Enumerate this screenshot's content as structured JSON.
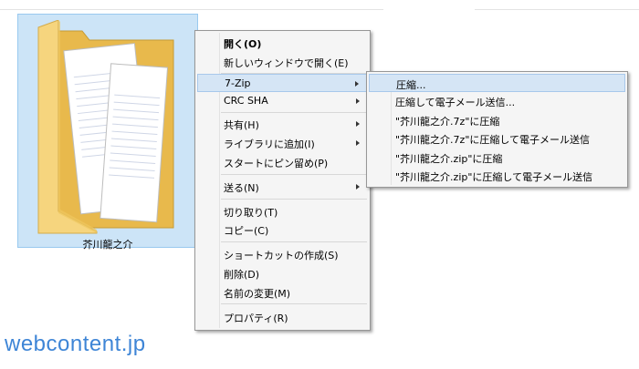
{
  "file": {
    "name": "芥川龍之介"
  },
  "context_menu": {
    "items": [
      {
        "label": "開く(O)"
      },
      {
        "label": "新しいウィンドウで開く(E)"
      },
      {
        "label": "7-Zip"
      },
      {
        "label": "CRC SHA"
      },
      {
        "label": "共有(H)"
      },
      {
        "label": "ライブラリに追加(I)"
      },
      {
        "label": "スタートにピン留め(P)"
      },
      {
        "label": "送る(N)"
      },
      {
        "label": "切り取り(T)"
      },
      {
        "label": "コピー(C)"
      },
      {
        "label": "ショートカットの作成(S)"
      },
      {
        "label": "削除(D)"
      },
      {
        "label": "名前の変更(M)"
      },
      {
        "label": "プロパティ(R)"
      }
    ]
  },
  "submenu_7zip": {
    "items": [
      {
        "label": "圧縮..."
      },
      {
        "label": "圧縮して電子メール送信..."
      },
      {
        "label": "\"芥川龍之介.7z\"に圧縮"
      },
      {
        "label": "\"芥川龍之介.7z\"に圧縮して電子メール送信"
      },
      {
        "label": "\"芥川龍之介.zip\"に圧縮"
      },
      {
        "label": "\"芥川龍之介.zip\"に圧縮して電子メール送信"
      }
    ]
  },
  "watermark": {
    "text": "webcontent.jp"
  },
  "colors": {
    "selection_bg": "#cce4f7",
    "menu_highlight": "#d5e5f5",
    "menu_bg": "#f5f5f5",
    "watermark": "#3e85d6",
    "folder": "#f3d27a"
  }
}
